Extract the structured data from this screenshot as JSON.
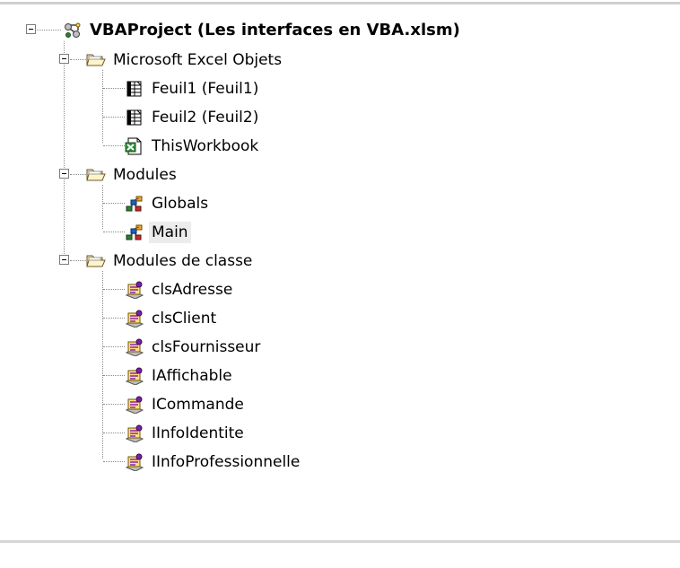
{
  "project": {
    "label": "VBAProject (Les interfaces en VBA.xlsm)",
    "icon": "vbaproject-icon",
    "expanded": true
  },
  "folders": [
    {
      "label": "Microsoft Excel Objets",
      "icon": "folder-open-icon",
      "expanded": true,
      "items": [
        {
          "label": "Feuil1 (Feuil1)",
          "icon": "worksheet-icon"
        },
        {
          "label": "Feuil2 (Feuil2)",
          "icon": "worksheet-icon"
        },
        {
          "label": "ThisWorkbook",
          "icon": "workbook-icon"
        }
      ]
    },
    {
      "label": "Modules",
      "icon": "folder-open-icon",
      "expanded": true,
      "items": [
        {
          "label": "Globals",
          "icon": "module-icon"
        },
        {
          "label": "Main",
          "icon": "module-icon",
          "selected": true
        }
      ]
    },
    {
      "label": "Modules de classe",
      "icon": "folder-open-icon",
      "expanded": true,
      "items": [
        {
          "label": "clsAdresse",
          "icon": "class-module-icon"
        },
        {
          "label": "clsClient",
          "icon": "class-module-icon"
        },
        {
          "label": "clsFournisseur",
          "icon": "class-module-icon"
        },
        {
          "label": "IAffichable",
          "icon": "class-module-icon"
        },
        {
          "label": "ICommande",
          "icon": "class-module-icon"
        },
        {
          "label": "IInfoIdentite",
          "icon": "class-module-icon"
        },
        {
          "label": "IInfoProfessionnelle",
          "icon": "class-module-icon"
        }
      ]
    }
  ]
}
